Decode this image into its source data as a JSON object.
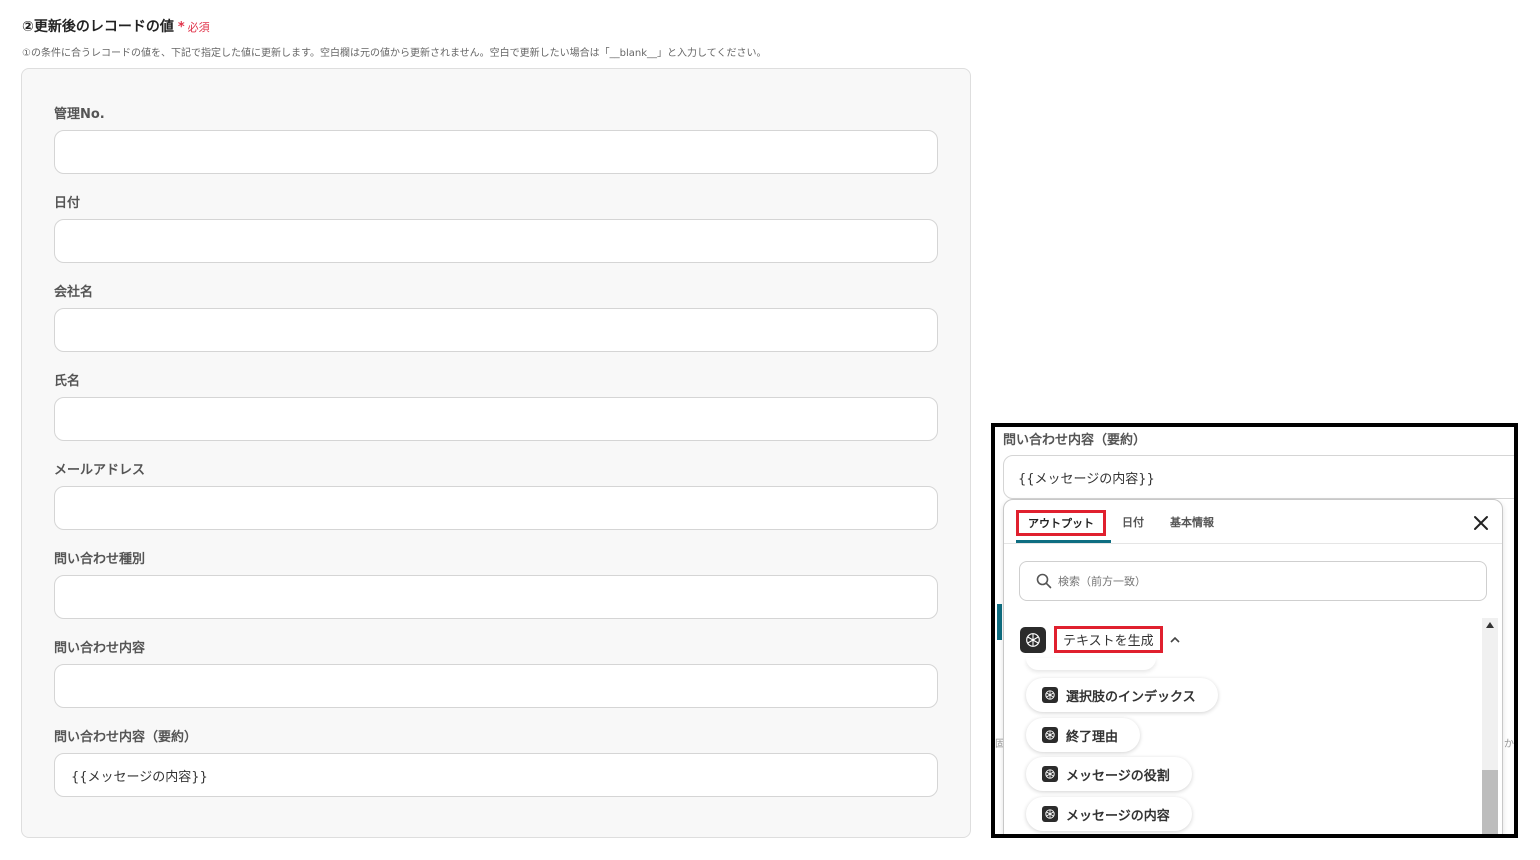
{
  "section": {
    "title": "②更新後のレコードの値",
    "required_mark": "*",
    "required_label": "必須",
    "description": "①の条件に合うレコードの値を、下記で指定した値に更新します。空白欄は元の値から更新されません。空白で更新したい場合は「__blank__」と入力してください。"
  },
  "fields": [
    {
      "label": "管理No.",
      "value": ""
    },
    {
      "label": "日付",
      "value": ""
    },
    {
      "label": "会社名",
      "value": ""
    },
    {
      "label": "氏名",
      "value": ""
    },
    {
      "label": "メールアドレス",
      "value": ""
    },
    {
      "label": "問い合わせ種別",
      "value": ""
    },
    {
      "label": "問い合わせ内容",
      "value": ""
    },
    {
      "label": "問い合わせ内容（要約）",
      "value": "{{メッセージの内容}}"
    }
  ],
  "inset": {
    "field_label": "問い合わせ内容（要約）",
    "field_value": "{{メッセージの内容}}",
    "bg_left_glyph": "固",
    "bg_right_glyph": "か",
    "dropdown": {
      "tabs": [
        "アウトプット",
        "日付",
        "基本情報"
      ],
      "active_tab": "アウトプット",
      "search_placeholder": "検索（前方一致）",
      "group_title": "テキストを生成",
      "items": [
        "選択肢のインデックス",
        "終了理由",
        "メッセージの役割",
        "メッセージの内容"
      ]
    }
  },
  "colors": {
    "required": "#e0334a",
    "highlight_border": "#e0202e",
    "tab_underline": "#0e6e82",
    "icon_bg": "#2b2b2b"
  }
}
